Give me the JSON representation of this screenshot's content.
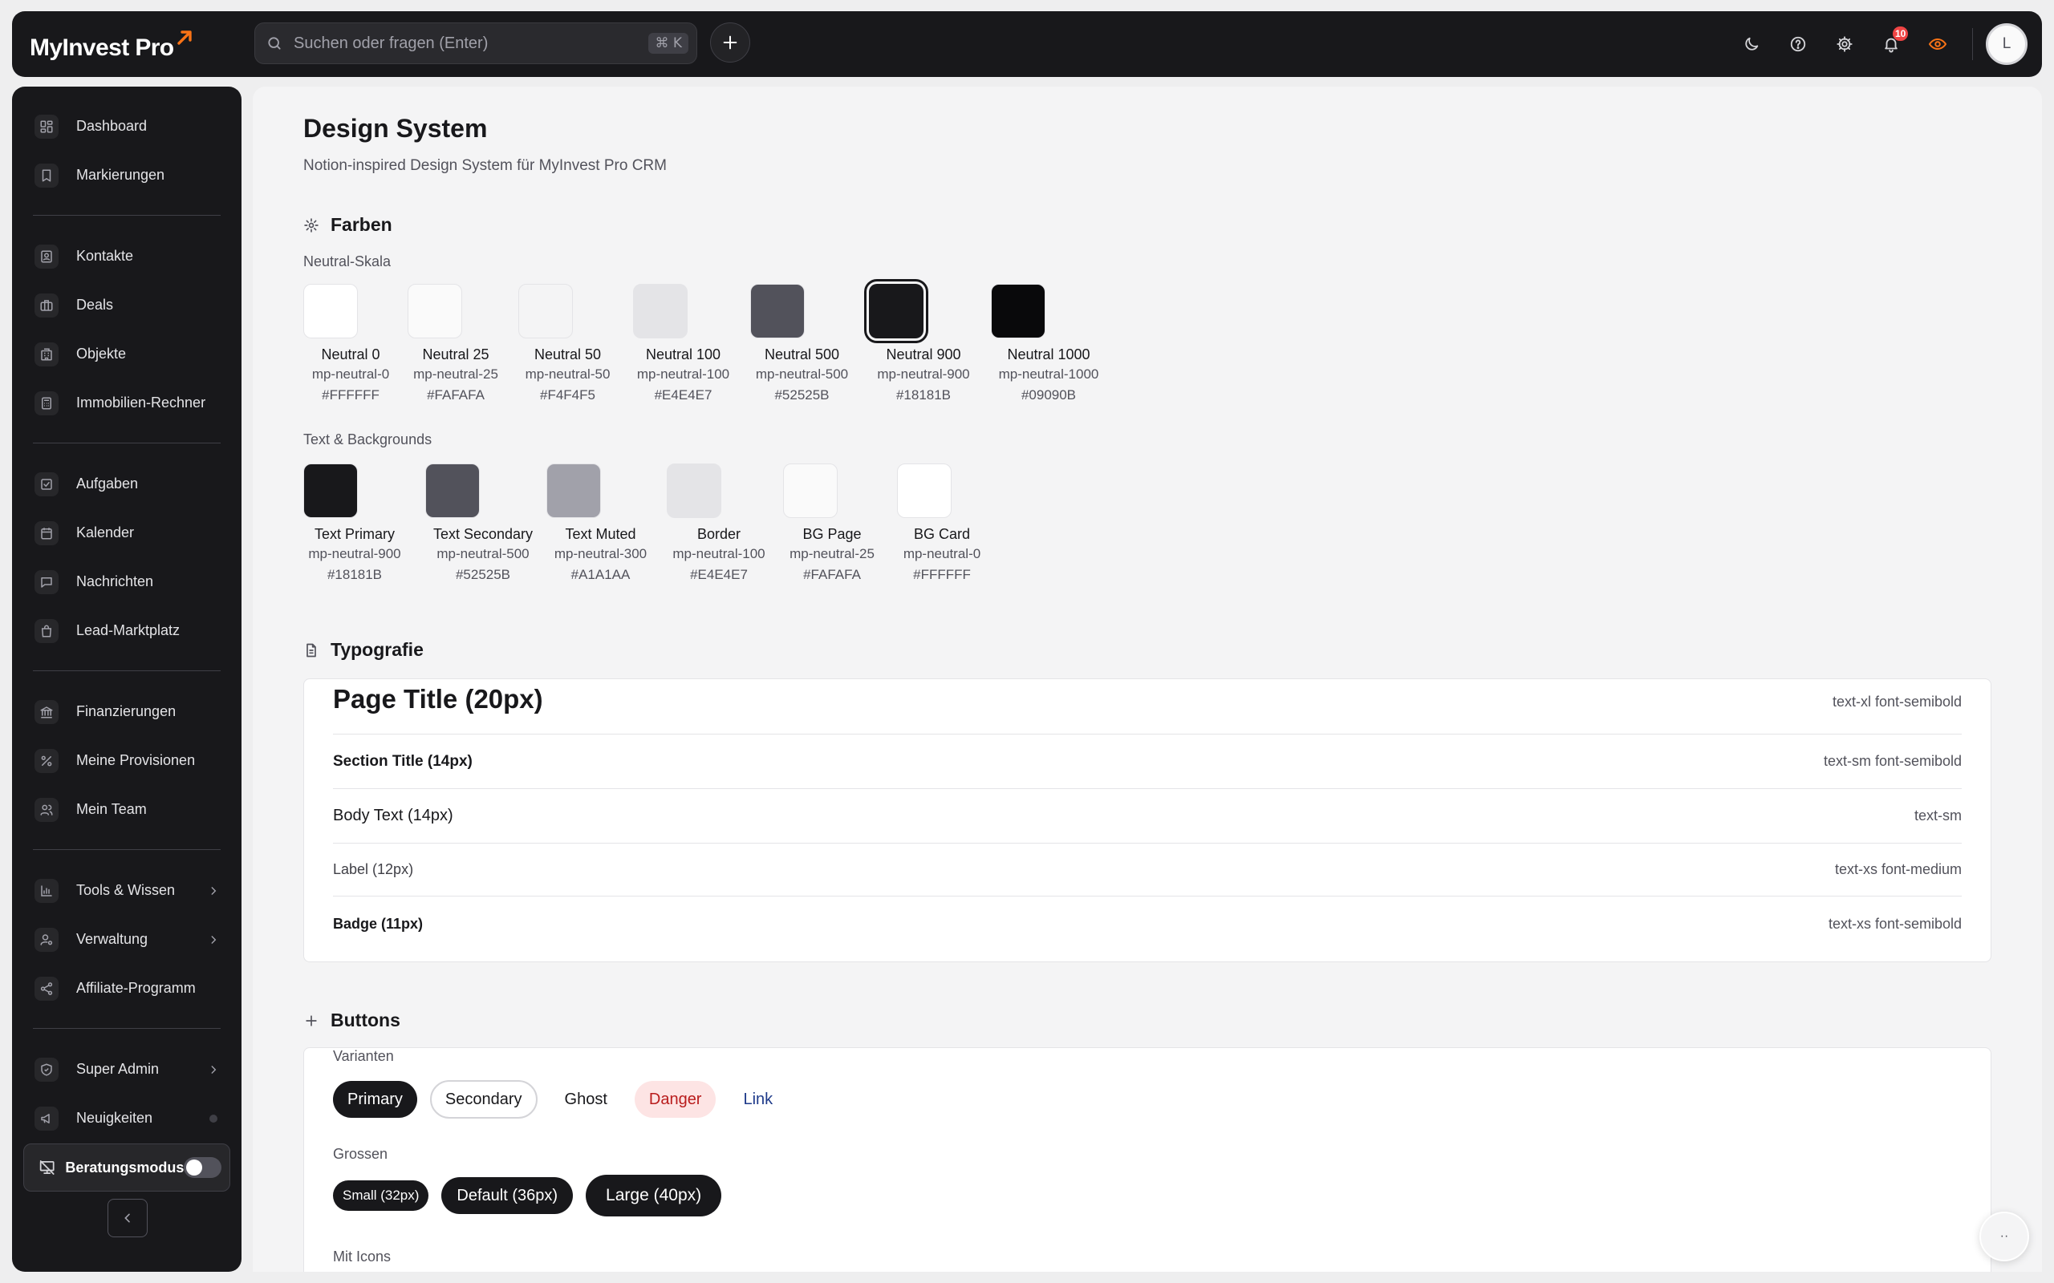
{
  "app": {
    "logo_text": "MyInvest Pro",
    "search_placeholder": "Suchen oder fragen (Enter)",
    "search_shortcut": "⌘ K",
    "notification_count": "10",
    "avatar_initial": "L",
    "accent_color": "#f97316"
  },
  "sidebar": {
    "groups": [
      [
        {
          "label": "Dashboard",
          "icon": "dashboard-icon"
        },
        {
          "label": "Markierungen",
          "icon": "bookmark-icon"
        }
      ],
      [
        {
          "label": "Kontakte",
          "icon": "contacts-icon"
        },
        {
          "label": "Deals",
          "icon": "briefcase-icon"
        },
        {
          "label": "Objekte",
          "icon": "building-icon"
        },
        {
          "label": "Immobilien-Rechner",
          "icon": "calculator-icon"
        }
      ],
      [
        {
          "label": "Aufgaben",
          "icon": "checkbox-icon"
        },
        {
          "label": "Kalender",
          "icon": "calendar-icon"
        },
        {
          "label": "Nachrichten",
          "icon": "message-icon"
        },
        {
          "label": "Lead-Marktplatz",
          "icon": "shopping-bag-icon"
        }
      ],
      [
        {
          "label": "Finanzierungen",
          "icon": "bank-icon"
        },
        {
          "label": "Meine Provisionen",
          "icon": "percent-icon"
        },
        {
          "label": "Mein Team",
          "icon": "team-icon"
        }
      ],
      [
        {
          "label": "Tools & Wissen",
          "icon": "bar-chart-icon"
        },
        {
          "label": "Verwaltung",
          "icon": "user-cog-icon"
        },
        {
          "label": "Affiliate-Programm",
          "icon": "share-icon"
        }
      ],
      [
        {
          "label": "Super Admin",
          "icon": "shield-icon"
        },
        {
          "label": "Neuigkeiten",
          "icon": "megaphone-icon"
        }
      ]
    ],
    "consult_mode_label": "Beratungsmodus"
  },
  "main": {
    "title": "Design System",
    "subtitle": "Notion-inspired Design System für MyInvest Pro CRM",
    "colors": {
      "heading": "Farben",
      "neutral_label": "Neutral-Skala",
      "neutral": [
        {
          "name": "Neutral 0",
          "token": "mp-neutral-0",
          "hex": "#FFFFFF"
        },
        {
          "name": "Neutral 25",
          "token": "mp-neutral-25",
          "hex": "#FAFAFA"
        },
        {
          "name": "Neutral 50",
          "token": "mp-neutral-50",
          "hex": "#F4F4F5"
        },
        {
          "name": "Neutral 100",
          "token": "mp-neutral-100",
          "hex": "#E4E4E7"
        },
        {
          "name": "Neutral 500",
          "token": "mp-neutral-500",
          "hex": "#52525B"
        },
        {
          "name": "Neutral 900",
          "token": "mp-neutral-900",
          "hex": "#18181B"
        },
        {
          "name": "Neutral 1000",
          "token": "mp-neutral-1000",
          "hex": "#09090B"
        }
      ],
      "text_bg_label": "Text & Backgrounds",
      "text_bg": [
        {
          "name": "Text Primary",
          "token": "mp-neutral-900",
          "hex": "#18181B"
        },
        {
          "name": "Text Secondary",
          "token": "mp-neutral-500",
          "hex": "#52525B"
        },
        {
          "name": "Text Muted",
          "token": "mp-neutral-300",
          "hex": "#A1A1AA"
        },
        {
          "name": "Border",
          "token": "mp-neutral-100",
          "hex": "#E4E4E7"
        },
        {
          "name": "BG Page",
          "token": "mp-neutral-25",
          "hex": "#FAFAFA"
        },
        {
          "name": "BG Card",
          "token": "mp-neutral-0",
          "hex": "#FFFFFF"
        }
      ]
    },
    "typography": {
      "heading": "Typografie",
      "rows": [
        {
          "sample": "Page Title (20px)",
          "classes": "text-xl font-semibold"
        },
        {
          "sample": "Section Title (14px)",
          "classes": "text-sm font-semibold"
        },
        {
          "sample": "Body Text (14px)",
          "classes": "text-sm"
        },
        {
          "sample": "Label (12px)",
          "classes": "text-xs font-medium"
        },
        {
          "sample": "Badge (11px)",
          "classes": "text-xs font-semibold"
        }
      ]
    },
    "buttons": {
      "heading": "Buttons",
      "variants_label": "Varianten",
      "variants": [
        "Primary",
        "Secondary",
        "Ghost",
        "Danger",
        "Link"
      ],
      "sizes_label": "Grossen",
      "sizes": [
        "Small (32px)",
        "Default (36px)",
        "Large (40px)"
      ],
      "icons_label": "Mit Icons"
    }
  },
  "help_fab_label": "··"
}
